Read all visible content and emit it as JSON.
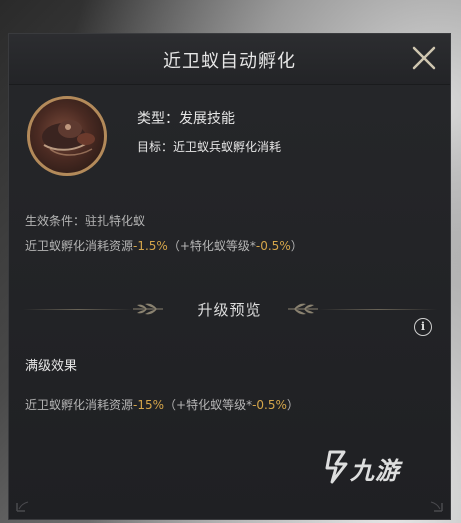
{
  "dialog": {
    "title": "近卫蚁自动孵化",
    "type_text": "类型：发展技能",
    "target_text": "目标：近卫蚁兵蚁孵化消耗",
    "condition_text": "生效条件：驻扎特化蚁",
    "effect": {
      "prefix": "近卫蚁孵化消耗资源",
      "value": "-1.5%",
      "mid": "（+特化蚁等级*",
      "per_level": "-0.5%",
      "suffix": "）"
    },
    "upgrade_section_title": "升级预览",
    "max_level_label": "满级效果",
    "max_effect": {
      "prefix": "近卫蚁孵化消耗资源",
      "value": "-15%",
      "mid": "（+特化蚁等级*",
      "per_level": "-0.5%",
      "suffix": "）"
    }
  },
  "icons": {
    "close": "close-icon",
    "info": "info-icon",
    "laurel": "laurel-icon"
  },
  "info_glyph": "i",
  "watermark": {
    "text": "九游"
  },
  "colors": {
    "panel_bg": "#232427",
    "highlight": "#d4a54a",
    "avatar_border": "#b38a5a",
    "text": "#e6e6e6",
    "muted_text": "#b5b5b5"
  }
}
